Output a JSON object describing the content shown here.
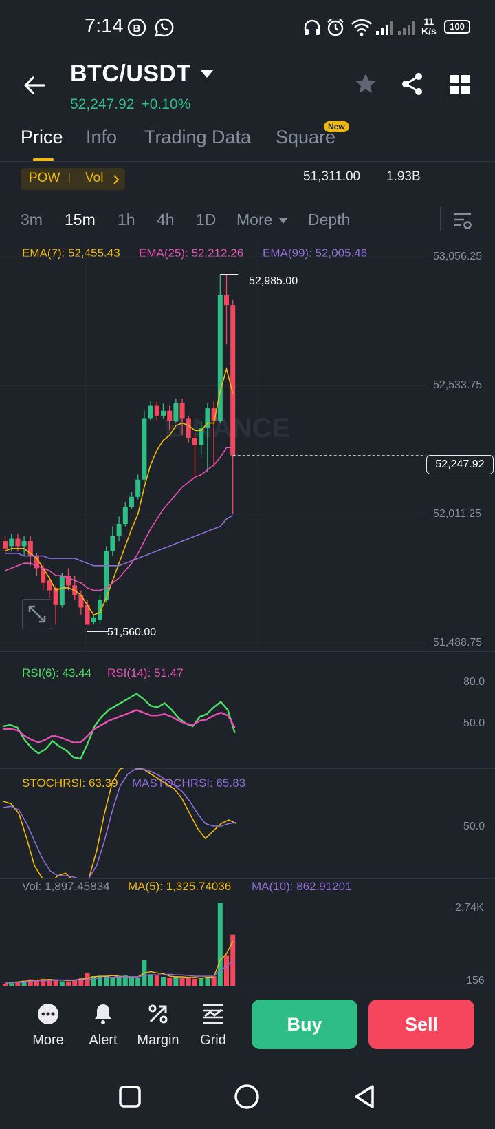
{
  "status_bar": {
    "time": "7:14",
    "net_speed_top": "11",
    "net_speed_unit": "K/s",
    "battery": "100"
  },
  "header": {
    "pair": "BTC/USDT",
    "last_price": "52,247.92",
    "change_pct": "+0.10%"
  },
  "tabs": [
    {
      "label": "Price",
      "active": true
    },
    {
      "label": "Info"
    },
    {
      "label": "Trading Data"
    },
    {
      "label": "Square",
      "badge": "New"
    }
  ],
  "tags": {
    "pow": "POW",
    "vol": "Vol",
    "value_1": "51,311.00",
    "value_2": "1.93B"
  },
  "intervals": [
    "3m",
    "15m",
    "1h",
    "4h",
    "1D",
    "More",
    "Depth"
  ],
  "active_interval": "15m",
  "ema_legend": {
    "ema7": "EMA(7): 52,455.43",
    "ema25": "EMA(25): 52,212.26",
    "ema99": "EMA(99): 52,005.46"
  },
  "price_axis": [
    "53,056.25",
    "52,533.75",
    "52,011.25",
    "51,488.75"
  ],
  "current_price_tag": "52,247.92",
  "high_marker": "52,985.00",
  "low_marker": "51,560.00",
  "watermark": "BINANCE",
  "rsi": {
    "rsi6": "RSI(6): 43.44",
    "rsi14": "RSI(14): 51.47",
    "axis": [
      "80.0",
      "50.0"
    ]
  },
  "stoch": {
    "stochrsi": "STOCHRSI: 63.39",
    "ma": "MASTOCHRSI: 65.83",
    "axis": "50.0"
  },
  "volume": {
    "vol": "Vol: 1,897.45834",
    "ma5": "MA(5): 1,325.74036",
    "ma10": "MA(10): 862.91201",
    "axis_top": "2.74K",
    "axis_bottom": "156"
  },
  "bottom_bar": {
    "more": "More",
    "alert": "Alert",
    "margin": "Margin",
    "grid": "Grid",
    "buy": "Buy",
    "sell": "Sell"
  },
  "colors": {
    "up": "#2ebd85",
    "down": "#f6465d",
    "ema7": "#f0b90b",
    "ema25": "#e84fb6",
    "ema99": "#8e6bd6",
    "accent": "#f0b90b"
  },
  "chart_data": {
    "type": "candlestick",
    "price_axis_range": [
      51488.75,
      53056.25
    ],
    "candles": [
      {
        "o": 51900,
        "c": 51870,
        "h": 51920,
        "l": 51850
      },
      {
        "o": 51880,
        "c": 51910,
        "h": 51930,
        "l": 51860
      },
      {
        "o": 51910,
        "c": 51880,
        "h": 51930,
        "l": 51860
      },
      {
        "o": 51880,
        "c": 51900,
        "h": 51920,
        "l": 51840
      },
      {
        "o": 51900,
        "c": 51840,
        "h": 51920,
        "l": 51800
      },
      {
        "o": 51840,
        "c": 51790,
        "h": 51850,
        "l": 51760
      },
      {
        "o": 51790,
        "c": 51730,
        "h": 51810,
        "l": 51700
      },
      {
        "o": 51740,
        "c": 51700,
        "h": 51760,
        "l": 51670
      },
      {
        "o": 51710,
        "c": 51640,
        "h": 51720,
        "l": 51560
      },
      {
        "o": 51640,
        "c": 51760,
        "h": 51770,
        "l": 51630
      },
      {
        "o": 51760,
        "c": 51720,
        "h": 51790,
        "l": 51700
      },
      {
        "o": 51720,
        "c": 51680,
        "h": 51760,
        "l": 51660
      },
      {
        "o": 51680,
        "c": 51630,
        "h": 51700,
        "l": 51600
      },
      {
        "o": 51640,
        "c": 51560,
        "h": 51660,
        "l": 51560
      },
      {
        "o": 51570,
        "c": 51590,
        "h": 51600,
        "l": 51560
      },
      {
        "o": 51580,
        "c": 51660,
        "h": 51680,
        "l": 51560
      },
      {
        "o": 51660,
        "c": 51860,
        "h": 51880,
        "l": 51650
      },
      {
        "o": 51860,
        "c": 51920,
        "h": 51960,
        "l": 51840
      },
      {
        "o": 51920,
        "c": 51970,
        "h": 52000,
        "l": 51900
      },
      {
        "o": 51970,
        "c": 52040,
        "h": 52060,
        "l": 51960
      },
      {
        "o": 52040,
        "c": 52080,
        "h": 52100,
        "l": 52030
      },
      {
        "o": 52080,
        "c": 52150,
        "h": 52170,
        "l": 52070
      },
      {
        "o": 52150,
        "c": 52400,
        "h": 52430,
        "l": 52140
      },
      {
        "o": 52400,
        "c": 52450,
        "h": 52470,
        "l": 52390
      },
      {
        "o": 52450,
        "c": 52410,
        "h": 52470,
        "l": 52390
      },
      {
        "o": 52410,
        "c": 52430,
        "h": 52460,
        "l": 52400
      },
      {
        "o": 52430,
        "c": 52390,
        "h": 52450,
        "l": 52350
      },
      {
        "o": 52390,
        "c": 52460,
        "h": 52480,
        "l": 52380
      },
      {
        "o": 52460,
        "c": 52400,
        "h": 52480,
        "l": 52330
      },
      {
        "o": 52400,
        "c": 52320,
        "h": 52410,
        "l": 52300
      },
      {
        "o": 52320,
        "c": 52290,
        "h": 52340,
        "l": 52160
      },
      {
        "o": 52290,
        "c": 52360,
        "h": 52390,
        "l": 52250
      },
      {
        "o": 52360,
        "c": 52440,
        "h": 52460,
        "l": 52180
      },
      {
        "o": 52440,
        "c": 52390,
        "h": 52470,
        "l": 52200
      },
      {
        "o": 52390,
        "c": 52900,
        "h": 52985,
        "l": 52380
      },
      {
        "o": 52900,
        "c": 52860,
        "h": 52985,
        "l": 52700
      },
      {
        "o": 52860,
        "c": 52248,
        "h": 52880,
        "l": 52011
      }
    ],
    "ema7": [
      51860,
      51870,
      51870,
      51870,
      51850,
      51830,
      51790,
      51750,
      51700,
      51710,
      51710,
      51700,
      51680,
      51640,
      51600,
      51610,
      51670,
      51740,
      51810,
      51880,
      51950,
      52010,
      52120,
      52210,
      52270,
      52310,
      52330,
      52370,
      52380,
      52370,
      52350,
      52350,
      52380,
      52380,
      52510,
      52600,
      52500
    ],
    "ema25": [
      51780,
      51790,
      51800,
      51810,
      51810,
      51800,
      51790,
      51780,
      51760,
      51760,
      51750,
      51740,
      51730,
      51710,
      51700,
      51700,
      51710,
      51730,
      51750,
      51780,
      51810,
      51850,
      51900,
      51950,
      51990,
      52030,
      52060,
      52090,
      52120,
      52140,
      52160,
      52170,
      52190,
      52210,
      52240,
      52280,
      52280
    ],
    "ema99": [
      51850,
      51850,
      51850,
      51840,
      51840,
      51840,
      51840,
      51830,
      51830,
      51830,
      51830,
      51830,
      51820,
      51810,
      51800,
      51800,
      51800,
      51800,
      51800,
      51810,
      51820,
      51830,
      51840,
      51850,
      51860,
      51870,
      51880,
      51890,
      51900,
      51910,
      51920,
      51930,
      51940,
      51950,
      51960,
      51990,
      52005
    ]
  }
}
